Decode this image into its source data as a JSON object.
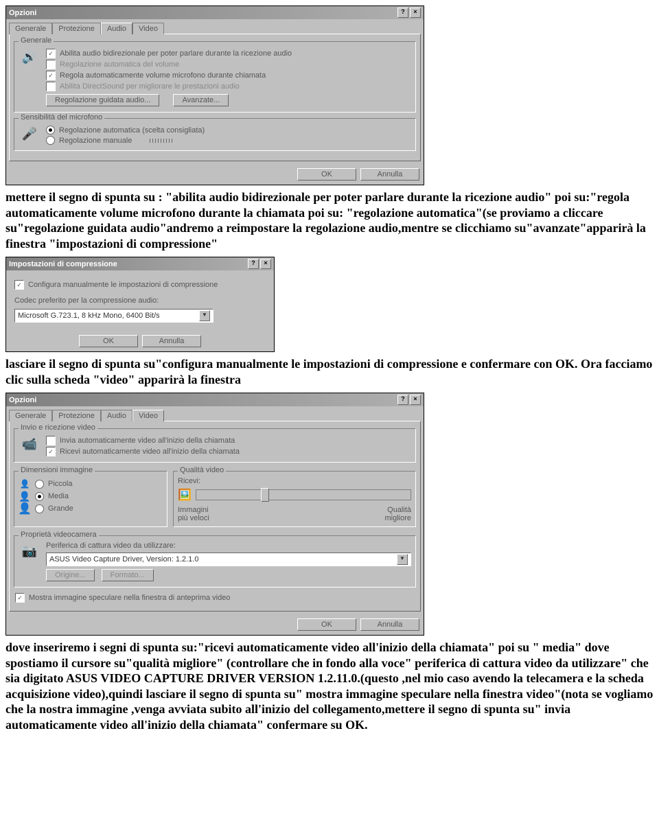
{
  "dialog1": {
    "title": "Opzioni",
    "tabs": [
      "Generale",
      "Protezione",
      "Audio",
      "Video"
    ],
    "active_tab": "Audio",
    "group_general": "Generale",
    "opts": {
      "a": "Abilita audio bidirezionale per poter parlare durante la ricezione audio",
      "b": "Regolazione automatica del volume",
      "c": "Regola automaticamente volume microfono durante chiamata",
      "d": "Abilita DirectSound per migliorare le prestazioni audio"
    },
    "btn_wizard": "Regolazione guidata audio...",
    "btn_adv": "Avanzate...",
    "group_sens": "Sensibilità del microfono",
    "sens_auto": "Regolazione automatica (scelta consigliata)",
    "sens_manual": "Regolazione manuale",
    "ok": "OK",
    "cancel": "Annulla"
  },
  "para1": "mettere il segno di spunta su : \"abilita audio bidirezionale per poter parlare durante la ricezione audio\"  poi su:\"regola automaticamente volume microfono durante la chiamata poi su: \"regolazione automatica\"(se proviamo a cliccare su\"regolazione guidata audio\"andremo a reimpostare la regolazione audio,mentre se clicchiamo su\"avanzate\"apparirà la finestra \"impostazioni di compressione\"",
  "dialog2": {
    "title": "Impostazioni di compressione",
    "opt_manual": "Configura manualmente le impostazioni di compressione",
    "codec_label": "Codec preferito per la compressione audio:",
    "codec_value": "Microsoft G.723.1, 8 kHz Mono, 6400 Bit/s",
    "ok": "OK",
    "cancel": "Annulla"
  },
  "para2": "lasciare il segno di spunta su\"configura manualmente le impostazioni di compressione e confermare con OK. Ora facciamo clic sulla scheda \"video\" apparirà la finestra",
  "dialog3": {
    "title": "Opzioni",
    "tabs": [
      "Generale",
      "Protezione",
      "Audio",
      "Video"
    ],
    "active_tab": "Video",
    "group_send": "Invio e ricezione video",
    "send_auto": "Invia automaticamente video all'inizio della chiamata",
    "recv_auto": "Ricevi automaticamente video all'inizio della chiamata",
    "group_dim": "Dimensioni immagine",
    "dim_small": "Piccola",
    "dim_med": "Media",
    "dim_large": "Grande",
    "group_quality": "Qualità video",
    "recv_label": "Ricevi:",
    "fast_label": "Immagini più veloci",
    "better_label": "Qualità migliore",
    "group_cam": "Proprietà videocamera",
    "cam_label": "Periferica di cattura video da utilizzare:",
    "cam_value": "ASUS Video Capture Driver, Version: 1.2.1.0",
    "btn_origin": "Origine...",
    "btn_format": "Formato...",
    "mirror": "Mostra immagine speculare nella finestra di anteprima video",
    "ok": "OK",
    "cancel": "Annulla"
  },
  "para3": "dove inseriremo i segni di spunta su:\"ricevi automaticamente video all'inizio della chiamata\" poi su \" media\"   dove   spostiamo il cursore su\"qualità migliore\" (controllare che in fondo alla voce\" periferica di cattura video da utilizzare\" che sia   digitato ASUS VIDEO CAPTURE DRIVER VERSION 1.2.11.0.(questo   ,nel mio caso avendo la telecamera e la scheda acquisizione video),quindi lasciare il segno di spunta su\" mostra immagine speculare nella finestra video\"(nota se vogliamo che la nostra immagine ,venga avviata subito all'inizio del collegamento,mettere il segno di spunta su\" invia automaticamente video all'inizio della chiamata\" confermare su OK."
}
